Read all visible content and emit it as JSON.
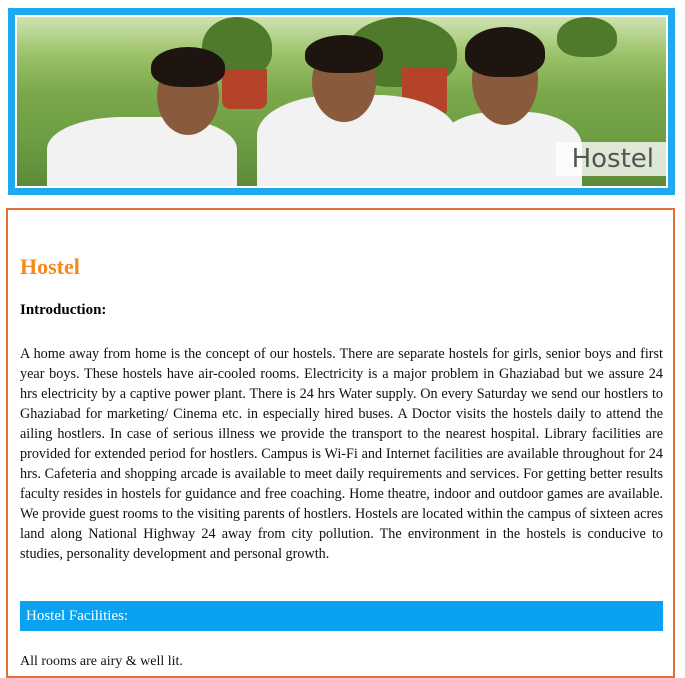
{
  "banner": {
    "caption": "Hostel",
    "photo_icon": "students-photo"
  },
  "content": {
    "title": "Hostel",
    "intro_heading": "Introduction:",
    "intro_body": "A home away from home is the concept of our hostels. There are separate hostels for girls, senior boys and first year boys. These hostels have air-cooled rooms. Electricity is a major problem in Ghaziabad but we assure 24 hrs electricity by a captive power plant. There is 24 hrs Water supply. On every Saturday we send our hostlers to Ghaziabad for marketing/ Cinema etc. in especially hired buses. A Doctor visits the hostels daily to attend the ailing hostlers. In case of serious illness we provide the transport to the nearest hospital. Library facilities are provided for extended period for hostlers. Campus is Wi-Fi and Internet facilities are available throughout for 24 hrs. Cafeteria and shopping arcade is available to meet daily requirements and services. For getting better results faculty resides in hostels for guidance and free coaching. Home theatre, indoor and outdoor games are available. We provide guest rooms to the visiting parents of hostlers. Hostels are located within the campus of sixteen acres land along National Highway 24 away from city pollution. The environment in the hostels is conducive to studies, personality development and personal growth.",
    "facilities_heading": "Hostel Facilities:",
    "facility_first": "All rooms are airy & well lit."
  },
  "colors": {
    "banner_border": "#1fa9f0",
    "title": "#f28a1a",
    "content_border": "#e0703a",
    "facility_bar": "#0aa2f0"
  }
}
